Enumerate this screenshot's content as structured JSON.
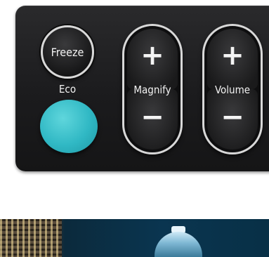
{
  "buttons": {
    "freeze_label": "Freeze",
    "eco_label": "Eco",
    "magnify": {
      "label": "Magnify",
      "plus": "+",
      "minus": "−"
    },
    "volume": {
      "label": "Volume",
      "plus": "+",
      "minus": "−"
    }
  },
  "colors": {
    "panel": "#1b1b1d",
    "eco_button": "#30b8c4",
    "button_ring": "#d8d8d8"
  }
}
